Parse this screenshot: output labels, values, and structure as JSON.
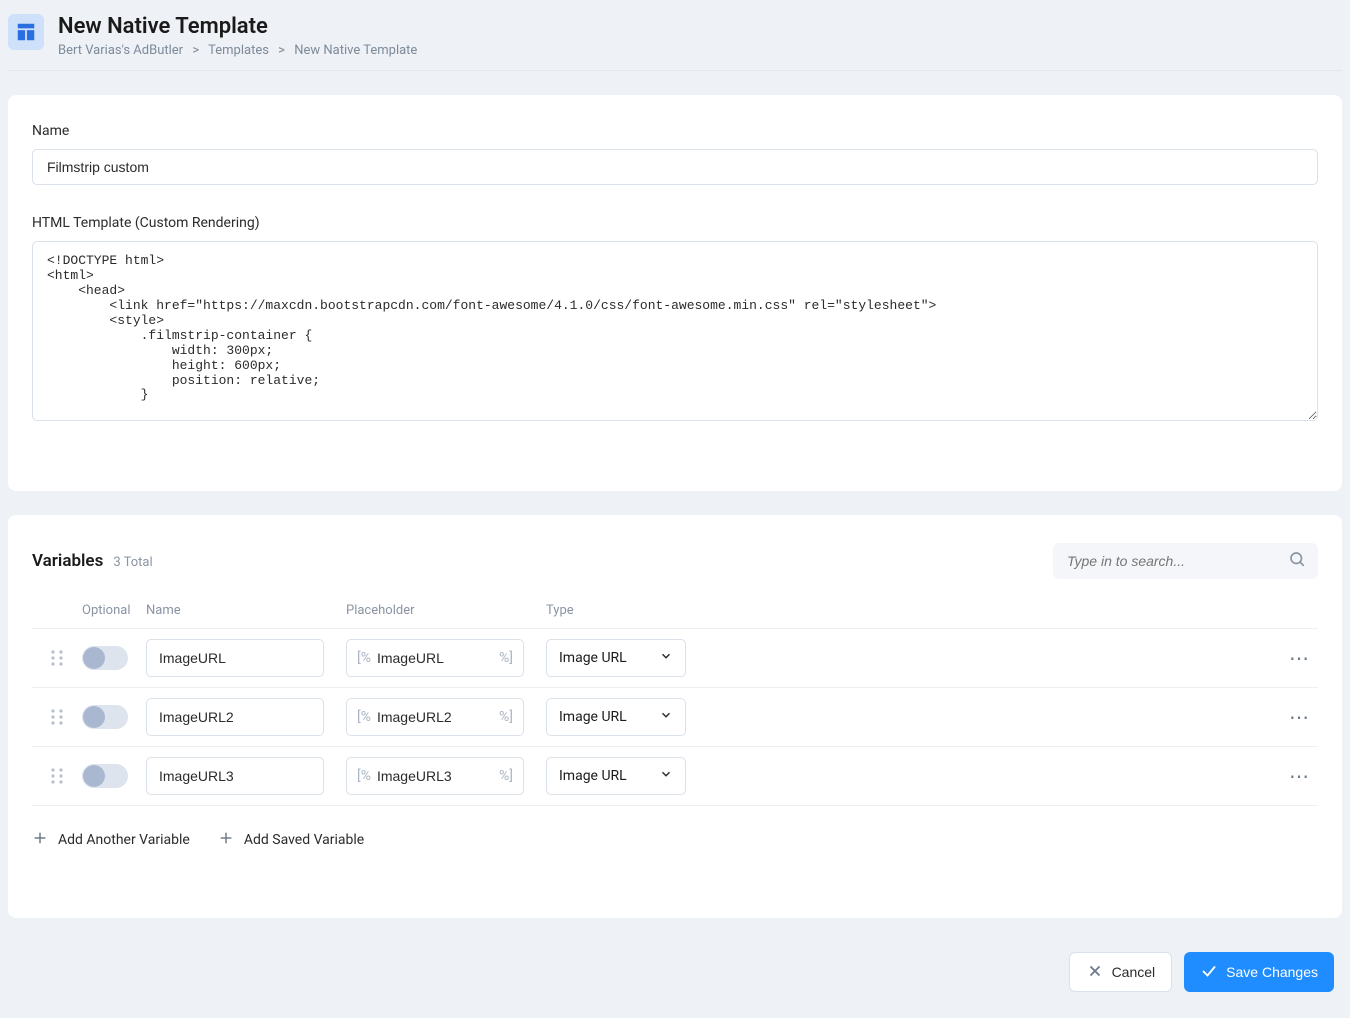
{
  "header": {
    "title": "New Native Template",
    "breadcrumb": [
      "Bert Varias's AdButler",
      "Templates",
      "New Native Template"
    ]
  },
  "form": {
    "name_label": "Name",
    "name_value": "Filmstrip custom",
    "html_label": "HTML Template (Custom Rendering)",
    "html_value": "<!DOCTYPE html>\n<html>\n    <head>\n        <link href=\"https://maxcdn.bootstrapcdn.com/font-awesome/4.1.0/css/font-awesome.min.css\" rel=\"stylesheet\">\n        <style>\n            .filmstrip-container {\n                width: 300px;\n                height: 600px;\n                position: relative;\n            }"
  },
  "variables": {
    "title": "Variables",
    "count_label": "3 Total",
    "search_placeholder": "Type in to search...",
    "columns": {
      "optional": "Optional",
      "name": "Name",
      "placeholder": "Placeholder",
      "type": "Type"
    },
    "rows": [
      {
        "optional": false,
        "name": "ImageURL",
        "placeholder": "ImageURL",
        "type": "Image URL"
      },
      {
        "optional": false,
        "name": "ImageURL2",
        "placeholder": "ImageURL2",
        "type": "Image URL"
      },
      {
        "optional": false,
        "name": "ImageURL3",
        "placeholder": "ImageURL3",
        "type": "Image URL"
      }
    ],
    "add_another": "Add Another Variable",
    "add_saved": "Add Saved Variable"
  },
  "footer": {
    "cancel": "Cancel",
    "save": "Save Changes"
  }
}
